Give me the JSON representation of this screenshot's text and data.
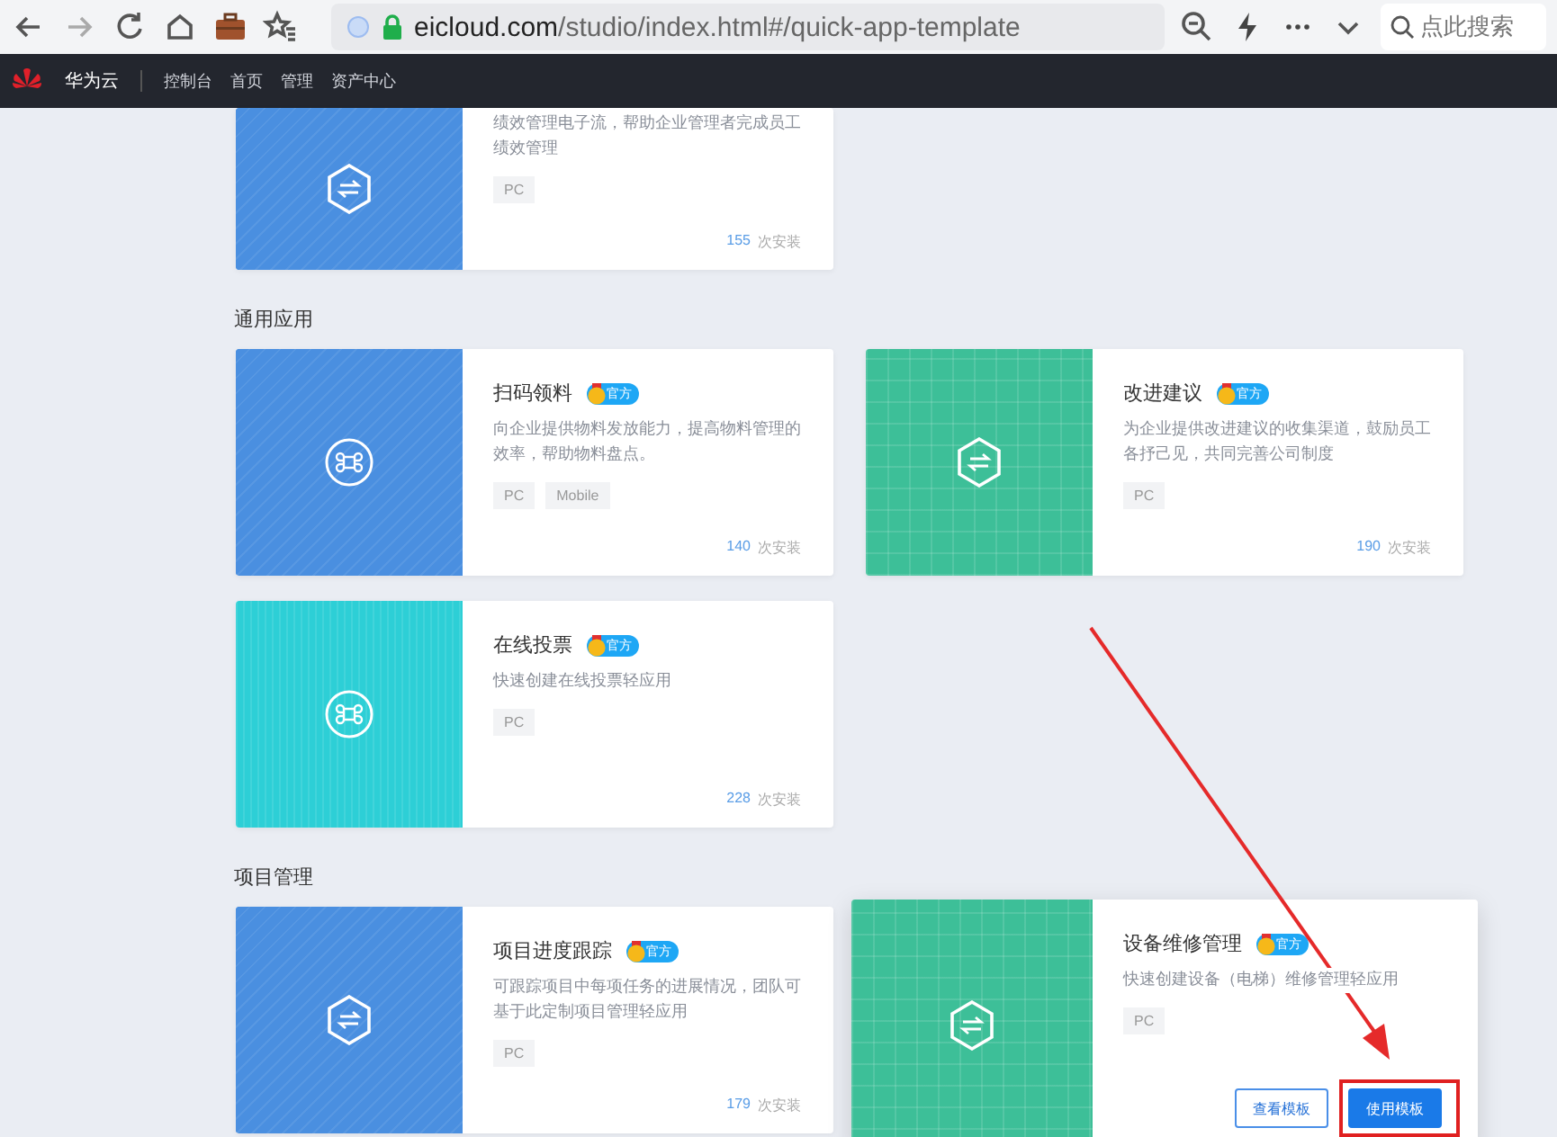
{
  "browser": {
    "url_host": "eicloud.com",
    "url_path": "/studio/index.html#/quick-app-template",
    "search": {
      "placeholder": "点此搜索"
    }
  },
  "nav": {
    "brand": "华为云",
    "items": [
      "控制台",
      "首页",
      "管理",
      "资产中心"
    ]
  },
  "top_card": {
    "description": "绩效管理电子流，帮助企业管理者完成员工绩效管理",
    "tags": [
      "PC"
    ],
    "installs": "155",
    "installs_label": "次安装",
    "cover": {
      "kind": "diagonal",
      "color": "#4a8fe0"
    },
    "symbol": {
      "kind": "hexagon"
    }
  },
  "sections": [
    {
      "title": "通用应用",
      "cards": [
        {
          "title": "扫码领料",
          "badge": "官方",
          "description": "向企业提供物料发放能力，提高物料管理的效率，帮助物料盘点。",
          "tags": [
            "PC",
            "Mobile"
          ],
          "installs": "140",
          "installs_label": "次安装",
          "cover": {
            "kind": "diagonal",
            "color": "#4a8fe0"
          },
          "symbol": {
            "kind": "command"
          },
          "hovered": false
        },
        {
          "title": "改进建议",
          "badge": "官方",
          "description": "为企业提供改进建议的收集渠道，鼓励员工各抒己见，共同完善公司制度",
          "tags": [
            "PC"
          ],
          "installs": "190",
          "installs_label": "次安装",
          "cover": {
            "kind": "grid",
            "color": "#3dbf98"
          },
          "symbol": {
            "kind": "hexagon"
          },
          "hovered": false
        },
        {
          "title": "在线投票",
          "badge": "官方",
          "description": "快速创建在线投票轻应用",
          "tags": [
            "PC"
          ],
          "installs": "228",
          "installs_label": "次安装",
          "cover": {
            "kind": "vertical",
            "color": "#2dcfd6"
          },
          "symbol": {
            "kind": "command"
          },
          "hovered": false
        }
      ]
    },
    {
      "title": "项目管理",
      "cards": [
        {
          "title": "项目进度跟踪",
          "badge": "官方",
          "description": "可跟踪项目中每项任务的进展情况，团队可基于此定制项目管理轻应用",
          "tags": [
            "PC"
          ],
          "installs": "179",
          "installs_label": "次安装",
          "cover": {
            "kind": "diagonal",
            "color": "#4a8fe0"
          },
          "symbol": {
            "kind": "hexagon"
          },
          "hovered": false
        },
        {
          "title": "设备维修管理",
          "badge": "官方",
          "description": "快速创建设备（电梯）维修管理轻应用",
          "tags": [
            "PC"
          ],
          "cover": {
            "kind": "grid",
            "color": "#3dbf98"
          },
          "symbol": {
            "kind": "hexagon"
          },
          "hovered": true,
          "buttons": [
            "查看模板",
            "使用模板"
          ]
        }
      ]
    }
  ]
}
